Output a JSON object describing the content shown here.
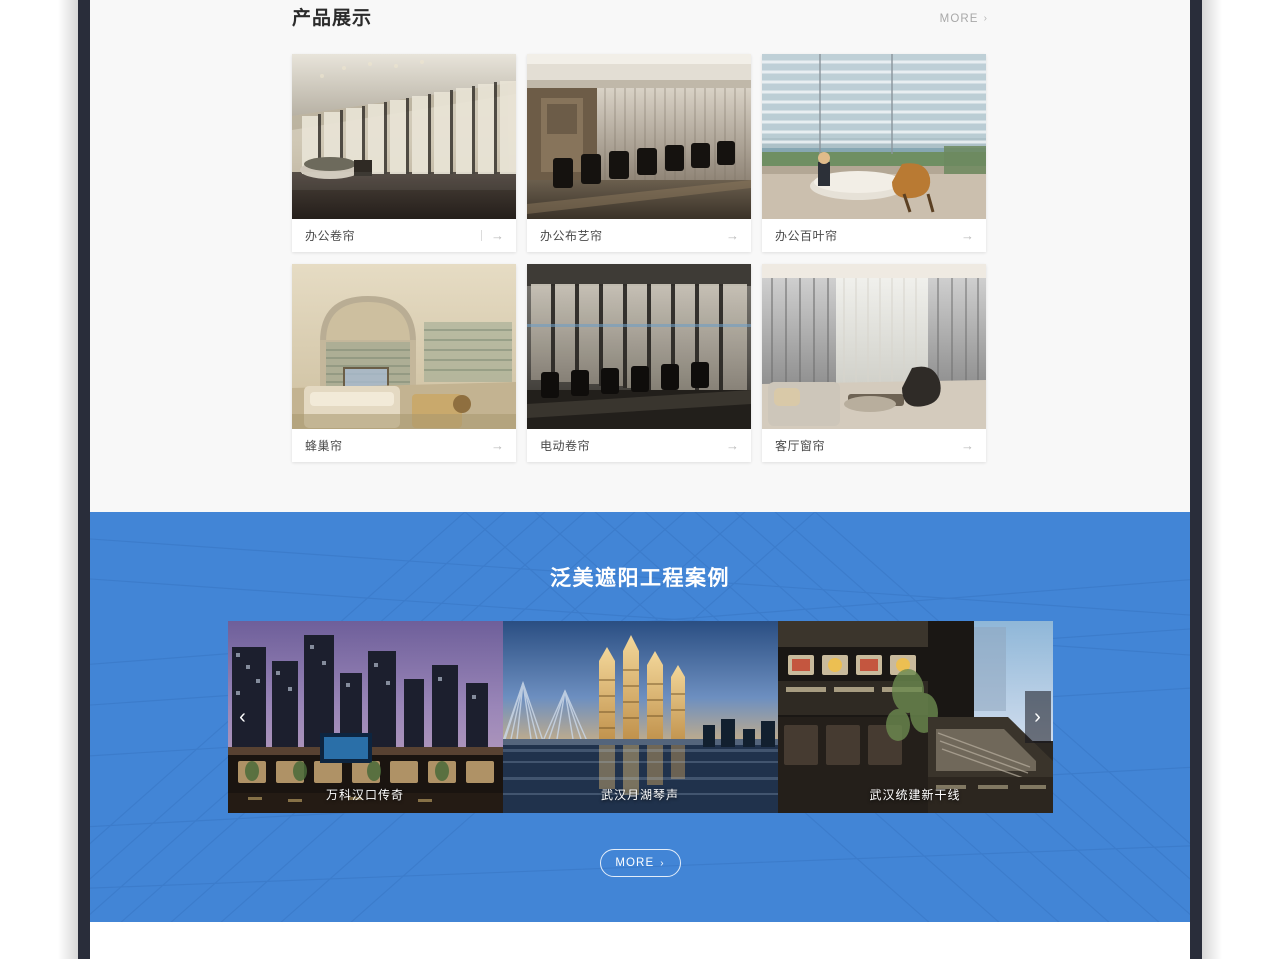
{
  "products": {
    "title": "产品展示",
    "more_label": "MORE",
    "more_chevron": "›",
    "arrow_glyph": "→",
    "items": [
      {
        "name": "办公卷帘",
        "image_alt": "office-roller-blind-interior"
      },
      {
        "name": "办公布艺帘",
        "image_alt": "office-fabric-curtain-meeting-room"
      },
      {
        "name": "办公百叶帘",
        "image_alt": "office-venetian-blind-lounge"
      },
      {
        "name": "蜂巢帘",
        "image_alt": "honeycomb-shade-bedroom"
      },
      {
        "name": "电动卷帘",
        "image_alt": "motorized-roller-blind-hall"
      },
      {
        "name": "客厅窗帘",
        "image_alt": "living-room-curtain"
      }
    ]
  },
  "cases": {
    "title": "泛美遮阳工程案例",
    "prev_glyph": "‹",
    "next_glyph": "›",
    "more_label": "MORE",
    "more_chevron": "›",
    "slides": [
      {
        "caption": "万科汉口传奇",
        "image_alt": "vanke-hankou-legend-mall-night"
      },
      {
        "caption": "武汉月湖琴声",
        "image_alt": "wuhan-yuehu-qinsheng-towers"
      },
      {
        "caption": "武汉统建新干线",
        "image_alt": "wuhan-tongjian-xinganxian-plaza"
      }
    ]
  },
  "colors": {
    "accent_blue": "#4285d6",
    "page_bg": "#f8f8f8",
    "frame_dark": "#292d3a",
    "card_bg": "#ffffff",
    "title_text": "#2b2b2b",
    "muted_text": "#a8a8a8"
  }
}
